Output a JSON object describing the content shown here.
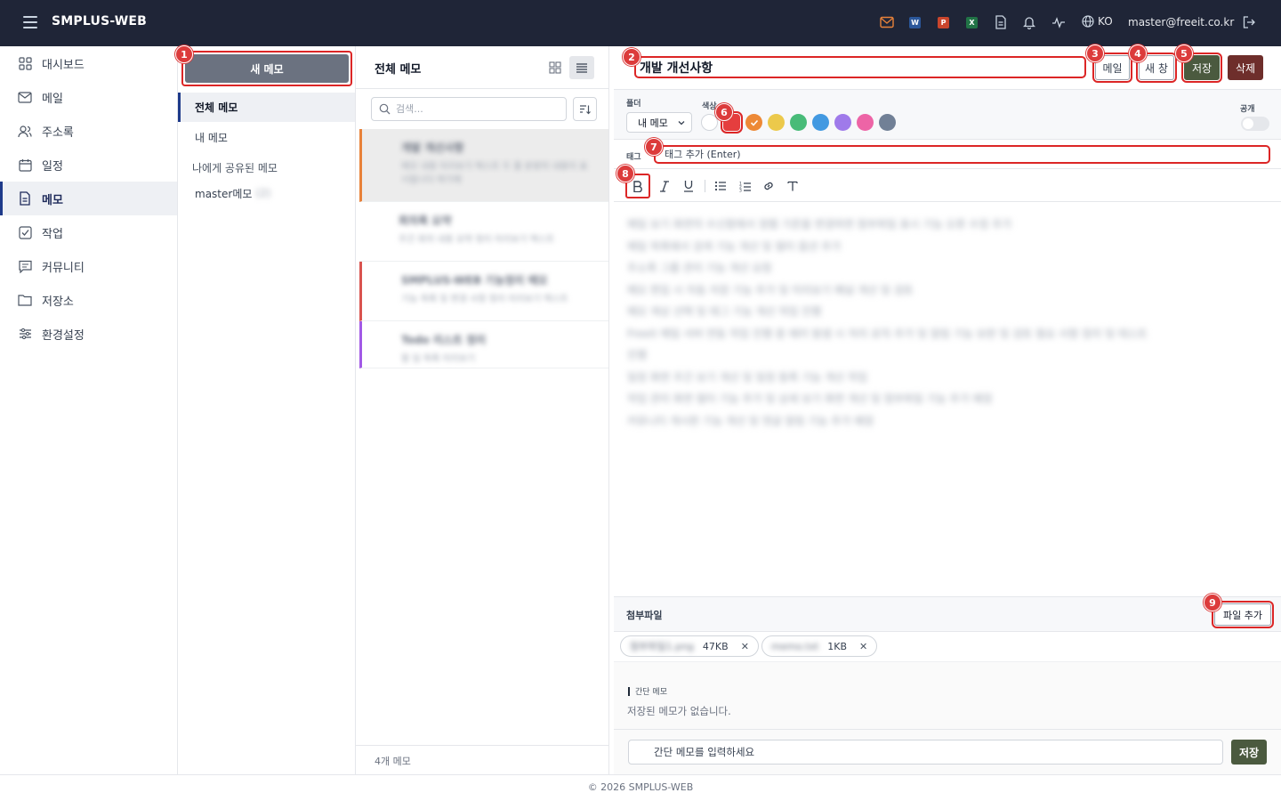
{
  "app": {
    "brand": "SMPLUS-WEB",
    "lang": "KO",
    "user_email": "master@freeit.co.kr",
    "footer": "© 2026 SMPLUS-WEB"
  },
  "topbar_icons": [
    "menu-icon",
    "mail-icon",
    "word-icon",
    "powerpoint-icon",
    "excel-icon",
    "document-icon",
    "bell-icon",
    "activity-icon",
    "globe-icon",
    "logout-icon"
  ],
  "topbar_apps": {
    "word": "W",
    "powerpoint": "P",
    "excel": "X"
  },
  "sidebar": {
    "items": [
      {
        "label": "대시보드",
        "icon": "dashboard-icon"
      },
      {
        "label": "메일",
        "icon": "mail-icon"
      },
      {
        "label": "주소록",
        "icon": "contacts-icon"
      },
      {
        "label": "일정",
        "icon": "calendar-icon"
      },
      {
        "label": "메모",
        "icon": "memo-icon",
        "active": true
      },
      {
        "label": "작업",
        "icon": "task-icon"
      },
      {
        "label": "커뮤니티",
        "icon": "community-icon"
      },
      {
        "label": "저장소",
        "icon": "folder-icon"
      },
      {
        "label": "환경설정",
        "icon": "settings-icon"
      }
    ]
  },
  "folders": {
    "new_memo": "새 메모",
    "items": [
      {
        "label": "전체 메모",
        "active": true
      },
      {
        "label": "내 메모"
      },
      {
        "label": "나에게 공유된 메모"
      },
      {
        "label": "master메모",
        "suffix": "(2)"
      }
    ]
  },
  "memo_list": {
    "title": "전체 메모",
    "search_placeholder": "검색...",
    "count": "4개 메모",
    "cards": [
      {
        "title": "개발 개선사항",
        "preview": "메모 내용 미리보기 텍스트 두 줄 분량의 내용이 표시됩니다 여기에",
        "color": "#e8823a",
        "selected": true
      },
      {
        "title": "회의록 요약",
        "preview": "주간 회의 내용 요약 정리 미리보기 텍스트",
        "color": ""
      },
      {
        "title": "SMPLUS-WEB 기능정리 메모",
        "preview": "기능 목록 및 변경 사항 정리 미리보기 텍스트",
        "color": "#d9534f"
      },
      {
        "title": "Todo 리스트 정리",
        "preview": "할 일 목록 미리보기",
        "color": "#a259e6"
      }
    ]
  },
  "editor": {
    "title": "개발 개선사항",
    "buttons": {
      "mail": "메일",
      "new_window": "새 창",
      "save": "저장",
      "delete": "삭제"
    },
    "folder_label": "폴더",
    "folder_value": "내 메모",
    "color_label": "색상",
    "public_label": "공개",
    "colors": [
      "#ffffff",
      "#e53e3e",
      "#ed8936",
      "#ecc94b",
      "#48bb78",
      "#4299e1",
      "#9f7aea",
      "#ed64a6",
      "#718096"
    ],
    "selected_color": "#ed8936",
    "tag_label": "태그",
    "tag_placeholder": "태그 추가 (Enter)",
    "toolbar_icons": [
      "bold-icon",
      "italic-icon",
      "underline-icon",
      "bullet-list-icon",
      "numbered-list-icon",
      "link-icon",
      "clear-format-icon"
    ],
    "content_lines": [
      "메일 보기 화면의 수신함에서 정렬 기준을 변경하면 첨부파일 표시 기능 오류 수정 추가",
      "메일 목록에서 검색 기능 개선 및 필터 옵션 추가",
      "주소록 그룹 관리 기능 개선 요청",
      "메모 편집 시 자동 저장 기능 추가 및 미리보기 패널 개선 및 검토",
      "메모 색상 선택 및 태그 기능 개선 작업 진행",
      "Freeit 메일 서버 연동 작업 진행 중 에러 발생 시 처리 로직 추가 및 알림 기능 보완 및 검토 필요 사항 정리 및 테스트",
      "진행",
      "일정 화면 주간 보기 개선 및 일정 등록 기능 개선 작업",
      "작업 관리 화면 필터 기능 추가 및 상세 보기 화면 개선 및 첨부파일 기능 추가 예정",
      "커뮤니티 게시판 기능 개선 및 댓글 알림 기능 추가 예정"
    ],
    "attachments_label": "첨부파일",
    "add_file": "파일 추가",
    "attachments": [
      {
        "name": "첨부파일1.png",
        "size": "47KB"
      },
      {
        "name": "memo.txt",
        "size": "1KB"
      }
    ],
    "quick_title": "간단 메모",
    "quick_empty": "저장된 메모가 없습니다.",
    "quick_placeholder": "간단 메모를 입력하세요",
    "quick_save": "저장"
  },
  "badges": [
    "1",
    "2",
    "3",
    "4",
    "5",
    "6",
    "7",
    "8",
    "9"
  ],
  "accent": {
    "primary_dark": "#1f2537",
    "save": "#4b5a3f",
    "delete": "#6e2e2b",
    "annotation": "#dc3b3b"
  }
}
